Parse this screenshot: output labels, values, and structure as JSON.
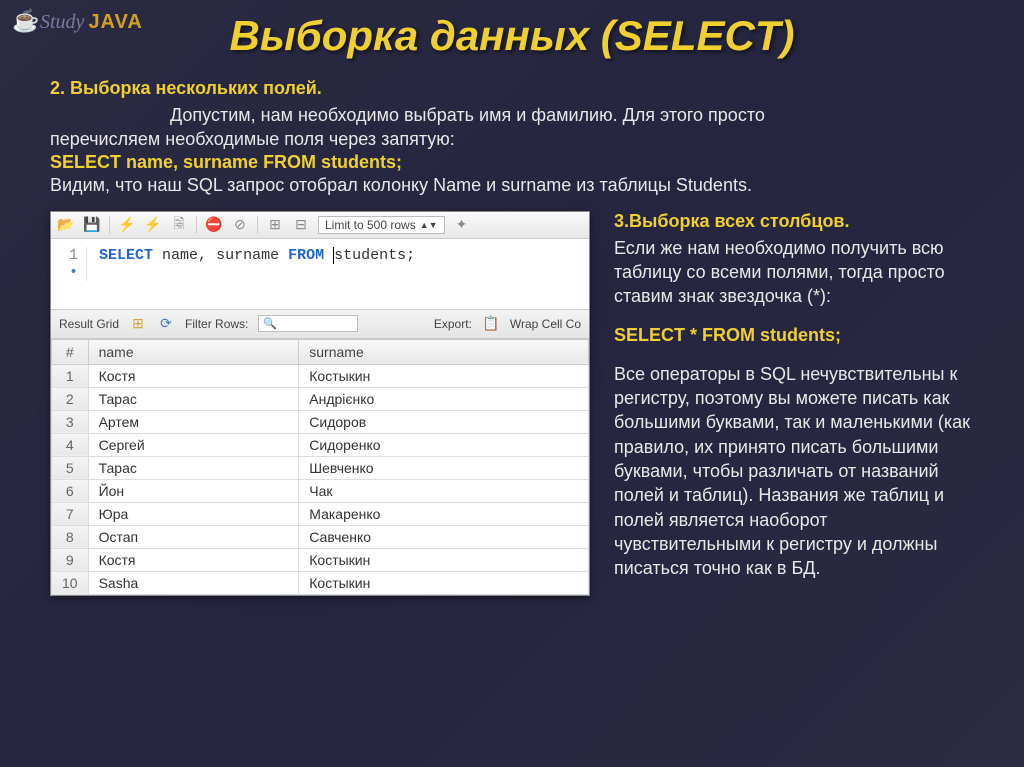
{
  "logo": {
    "text1": "Study",
    "text2": "JAVA"
  },
  "title": "Выборка данных (SELECT)",
  "section2": {
    "header": "2. Выборка нескольких полей.",
    "line1": "Допустим, нам необходимо выбрать имя и фамилию. Для этого просто",
    "line2": "перечисляем необходимые поля через запятую:",
    "sql": "SELECT name, surname FROM students;",
    "line3": "Видим, что наш SQL запрос отобрал колонку Name и surname из таблицы Students."
  },
  "sqlWindow": {
    "limitLabel": "Limit to 500 rows",
    "lineNum": "1",
    "bullet": "•",
    "kw1": "SELECT",
    "col1": "name",
    "comma": ",",
    "col2": "surname",
    "kw2": "FROM",
    "table": "students;",
    "resultGrid": "Result Grid",
    "filterLabel": "Filter Rows:",
    "exportLabel": "Export:",
    "wrapLabel": "Wrap Cell Co",
    "headers": {
      "num": "#",
      "name": "name",
      "surname": "surname"
    },
    "rows": [
      {
        "n": "1",
        "name": "Костя",
        "surname": "Костыкин"
      },
      {
        "n": "2",
        "name": "Тарас",
        "surname": "Андрієнко"
      },
      {
        "n": "3",
        "name": "Артем",
        "surname": "Сидоров"
      },
      {
        "n": "4",
        "name": "Сергей",
        "surname": "Сидоренко"
      },
      {
        "n": "5",
        "name": "Тарас",
        "surname": "Шевченко"
      },
      {
        "n": "6",
        "name": "Йон",
        "surname": "Чак"
      },
      {
        "n": "7",
        "name": "Юра",
        "surname": "Макаренко"
      },
      {
        "n": "8",
        "name": "Остап",
        "surname": "Савченко"
      },
      {
        "n": "9",
        "name": "Костя",
        "surname": "Костыкин"
      },
      {
        "n": "10",
        "name": "Sasha",
        "surname": "Костыкин"
      }
    ]
  },
  "section3": {
    "header": "3.Выборка всех столбцов.",
    "p1": "Если же нам необходимо получить всю таблицу со всеми полями, тогда просто ставим знак звездочка (*):",
    "sql": "SELECT * FROM students;",
    "p2": "Все операторы в SQL нечувствительны к регистру, поэтому вы можете писать как большими буквами, так и маленькими (как правило, их принято писать большими буквами, чтобы различать от названий полей и таблиц). Названия же таблиц и полей является наоборот чувствительными к регистру и должны писаться точно как в БД."
  }
}
